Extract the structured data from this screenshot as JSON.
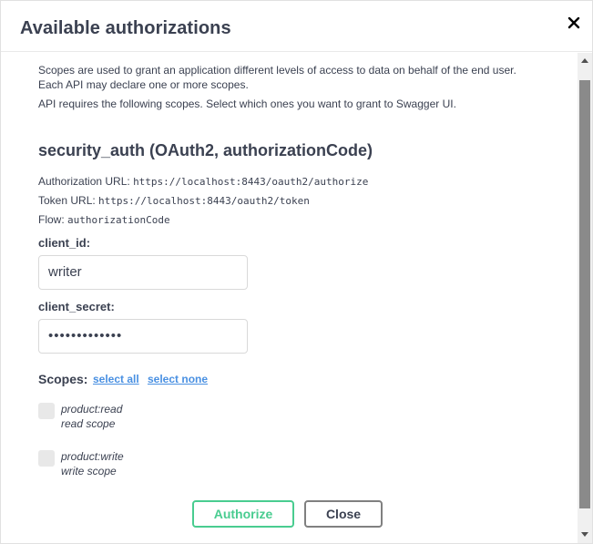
{
  "modal": {
    "title": "Available authorizations"
  },
  "intro": {
    "line1": "Scopes are used to grant an application different levels of access to data on behalf of the end user.",
    "line2": "Each API may declare one or more scopes.",
    "line3": "API requires the following scopes. Select which ones you want to grant to Swagger UI."
  },
  "auth": {
    "title": "security_auth (OAuth2, authorizationCode)",
    "authorization_url_label": "Authorization URL:",
    "authorization_url": "https://localhost:8443/oauth2/authorize",
    "token_url_label": "Token URL:",
    "token_url": "https://localhost:8443/oauth2/token",
    "flow_label": "Flow:",
    "flow": "authorizationCode"
  },
  "client_id": {
    "label": "client_id:",
    "value": "writer"
  },
  "client_secret": {
    "label": "client_secret:",
    "value": "•••••••••••••"
  },
  "scopes": {
    "label": "Scopes:",
    "select_all": "select all",
    "select_none": "select none",
    "items": [
      {
        "name": "product:read",
        "description": "read scope",
        "checked": false
      },
      {
        "name": "product:write",
        "description": "write scope",
        "checked": false
      }
    ]
  },
  "buttons": {
    "authorize": "Authorize",
    "close": "Close"
  },
  "icons": {
    "close": "close-icon",
    "scroll_up": "chevron-up-icon",
    "scroll_down": "chevron-down-icon"
  },
  "colors": {
    "authorize_accent": "#49cc90",
    "link": "#4990e2",
    "text": "#3b4151"
  }
}
